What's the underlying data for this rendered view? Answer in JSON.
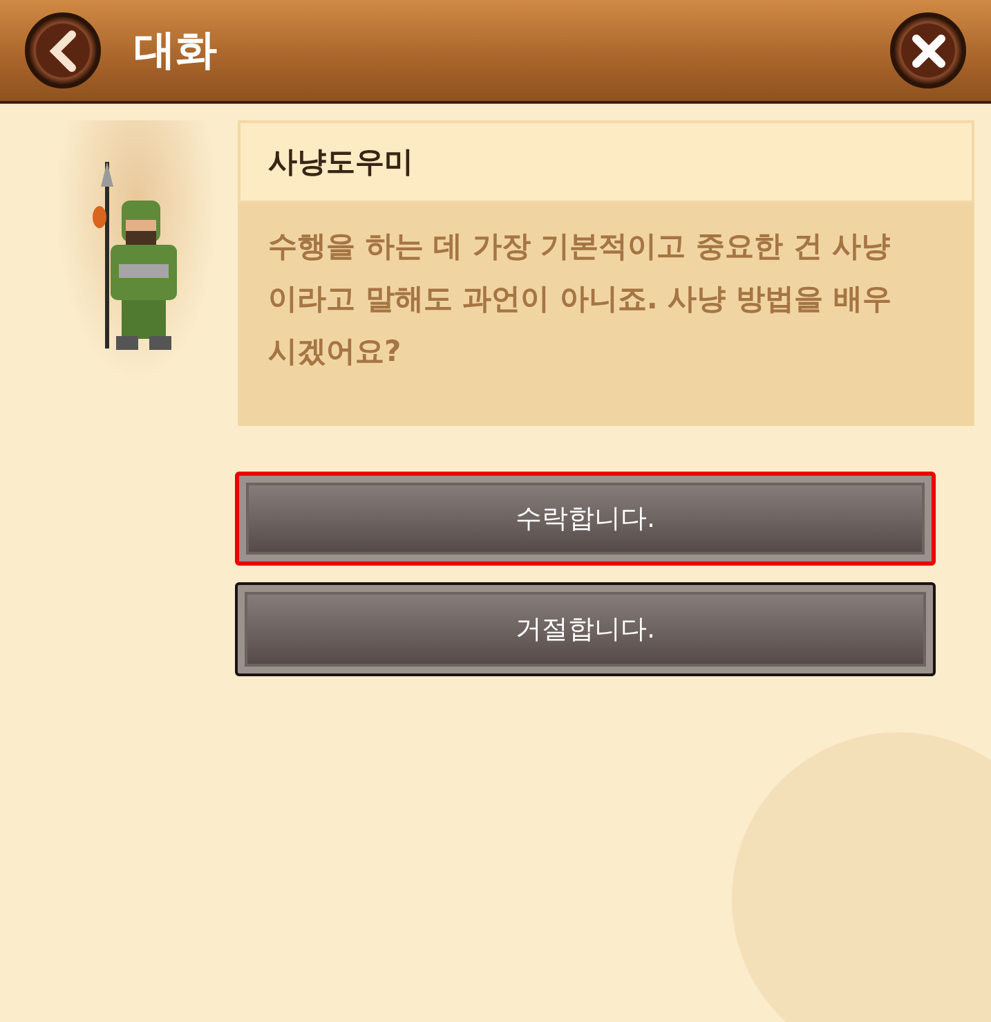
{
  "header": {
    "title": "대화"
  },
  "dialog": {
    "speaker": "사냥도우미",
    "text": "수행을 하는 데 가장 기본적이고 중요한 건 사냥이라고 말해도 과언이 아니죠. 사냥 방법을 배우시겠어요?"
  },
  "choices": [
    {
      "label": "수락합니다.",
      "selected": true
    },
    {
      "label": "거절합니다.",
      "selected": false
    }
  ]
}
